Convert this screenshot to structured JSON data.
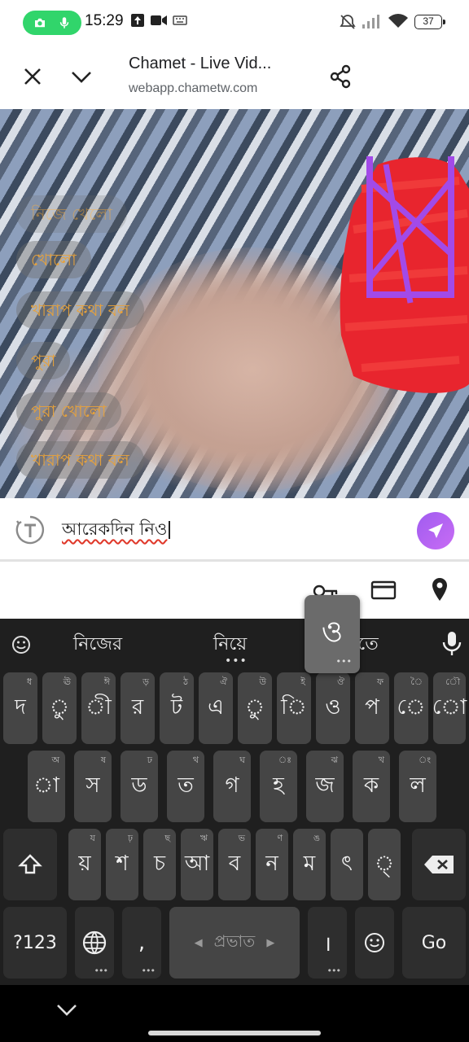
{
  "status_bar": {
    "time": "15:29",
    "battery": "37",
    "icons": [
      "camera-icon",
      "mic-icon",
      "upload-icon",
      "video-icon",
      "keyboard-icon",
      "mute-icon",
      "signal-icon",
      "wifi-icon"
    ]
  },
  "browser": {
    "page_title": "Chamet - Live Vid...",
    "url": "webapp.chametw.com"
  },
  "video": {
    "chips": [
      "নিজে খেলো",
      "খোলো",
      "খারাপ কথা বল",
      "পুরা",
      "পুরা খোলো",
      "খারাপ কথা বল"
    ]
  },
  "composer": {
    "text": "আরেকদিন নিও"
  },
  "keyboard": {
    "suggestions": [
      "নিজের",
      "নিয়ে",
      "নিতে"
    ],
    "popup_key": "ও",
    "row1": [
      {
        "label": "দ",
        "hint": "ধ"
      },
      {
        "label": "ু",
        "hint": "ঊ"
      },
      {
        "label": "ী",
        "hint": "ঈ"
      },
      {
        "label": "র",
        "hint": "ড়"
      },
      {
        "label": "ট",
        "hint": "ঠ"
      },
      {
        "label": "এ",
        "hint": "ঐ"
      },
      {
        "label": "ু",
        "hint": "উ"
      },
      {
        "label": "ি",
        "hint": "ই"
      },
      {
        "label": "ও",
        "hint": "ঔ"
      },
      {
        "label": "প",
        "hint": "ফ"
      },
      {
        "label": "ে",
        "hint": "ৈ"
      },
      {
        "label": "ো",
        "hint": "ৌ"
      }
    ],
    "row2": [
      {
        "label": "া",
        "hint": "অ"
      },
      {
        "label": "স",
        "hint": "ষ"
      },
      {
        "label": "ড",
        "hint": "ঢ"
      },
      {
        "label": "ত",
        "hint": "থ"
      },
      {
        "label": "গ",
        "hint": "ঘ"
      },
      {
        "label": "হ",
        "hint": "ঃ"
      },
      {
        "label": "জ",
        "hint": "ঝ"
      },
      {
        "label": "ক",
        "hint": "খ"
      },
      {
        "label": "ল",
        "hint": "ং"
      }
    ],
    "row3": [
      {
        "label": "য়",
        "hint": "য"
      },
      {
        "label": "শ",
        "hint": "ঢ়"
      },
      {
        "label": "চ",
        "hint": "ছ"
      },
      {
        "label": "আ",
        "hint": "ঋ"
      },
      {
        "label": "ব",
        "hint": "ভ"
      },
      {
        "label": "ন",
        "hint": "ণ"
      },
      {
        "label": "ম",
        "hint": "ঙ"
      },
      {
        "label": "ৎ",
        "hint": ""
      },
      {
        "label": "্",
        "hint": ""
      }
    ],
    "symbols_label": "?123",
    "comma_label": ",",
    "space_label": "প্রভাত",
    "danda_label": "।",
    "go_label": "Go"
  }
}
